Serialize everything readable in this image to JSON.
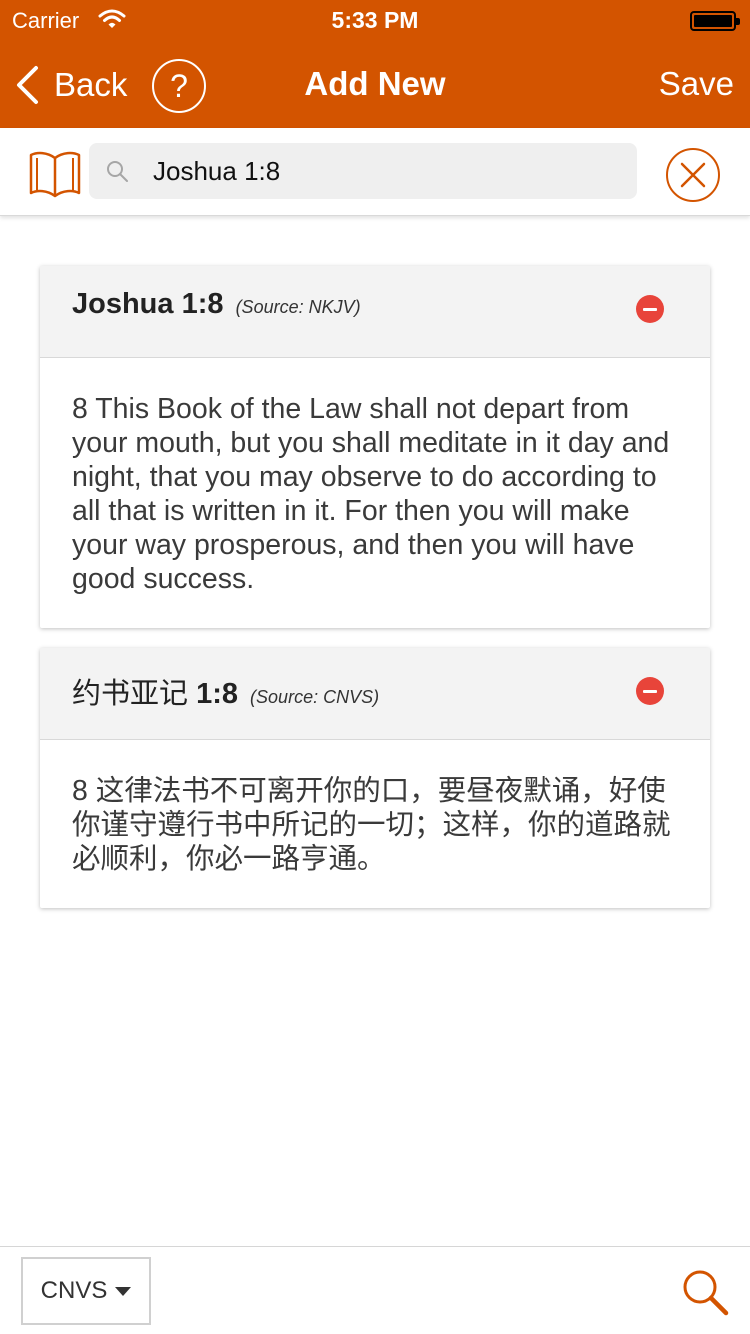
{
  "status_bar": {
    "carrier": "Carrier",
    "time": "5:33 PM"
  },
  "nav": {
    "back_label": "Back",
    "help_label": "?",
    "title": "Add New",
    "save_label": "Save"
  },
  "search": {
    "value": "Joshua 1:8"
  },
  "cards": [
    {
      "ref_prefix": "",
      "ref_bold": "Joshua 1:8",
      "source": "(Source: NKJV)",
      "text": "8 This Book of the Law shall not depart from your mouth, but you shall meditate in it day and night, that you may observe to do according to all that is written in it. For then you will make your way prosperous, and then you will have good success."
    },
    {
      "ref_prefix": "约书亚记 ",
      "ref_bold": "1:8",
      "source": "(Source: CNVS)",
      "text": "8 这律法书不可离开你的口，要昼夜默诵，好使你谨守遵行书中所记的一切；这样，你的道路就必顺利，你必一路亨通。"
    }
  ],
  "bottom": {
    "version": "CNVS"
  },
  "colors": {
    "accent": "#d35400",
    "remove": "#e8443a"
  },
  "icons": [
    "wifi-icon",
    "battery-icon",
    "back-chevron-icon",
    "book-icon",
    "search-icon",
    "close-icon",
    "remove-icon",
    "dropdown-caret-icon"
  ]
}
